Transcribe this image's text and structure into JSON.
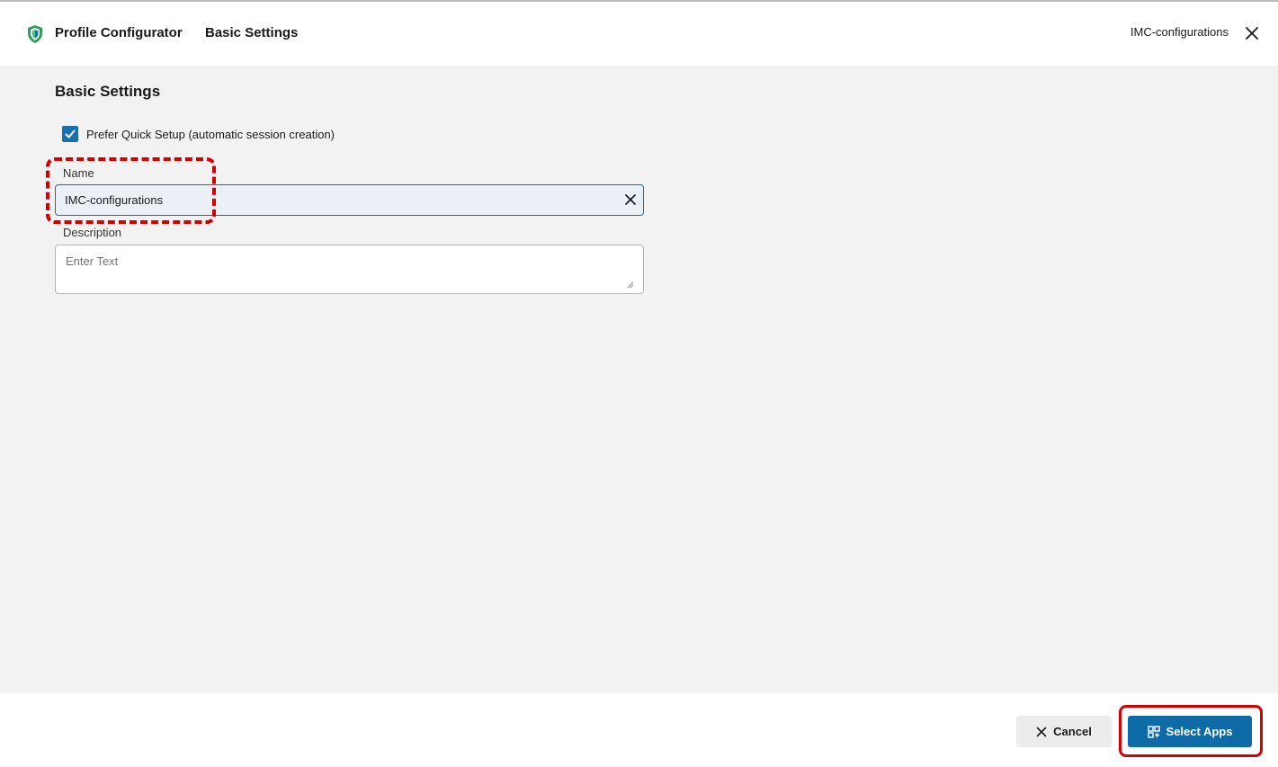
{
  "header": {
    "app_title": "Profile Configurator",
    "page_title": "Basic Settings",
    "profile_name": "IMC-configurations",
    "logo_icon": "shield-icon",
    "close_icon": "close-icon"
  },
  "form": {
    "section_title": "Basic Settings",
    "quick_setup": {
      "label": "Prefer Quick Setup (automatic session creation)",
      "checked": true
    },
    "name": {
      "label": "Name",
      "value": "IMC-configurations"
    },
    "description": {
      "label": "Description",
      "placeholder": "Enter Text",
      "value": ""
    }
  },
  "footer": {
    "cancel_label": "Cancel",
    "select_apps_label": "Select Apps"
  },
  "colors": {
    "accent": "#0f6aa8",
    "highlight": "#d40000",
    "shield": "#2e9e5b"
  }
}
